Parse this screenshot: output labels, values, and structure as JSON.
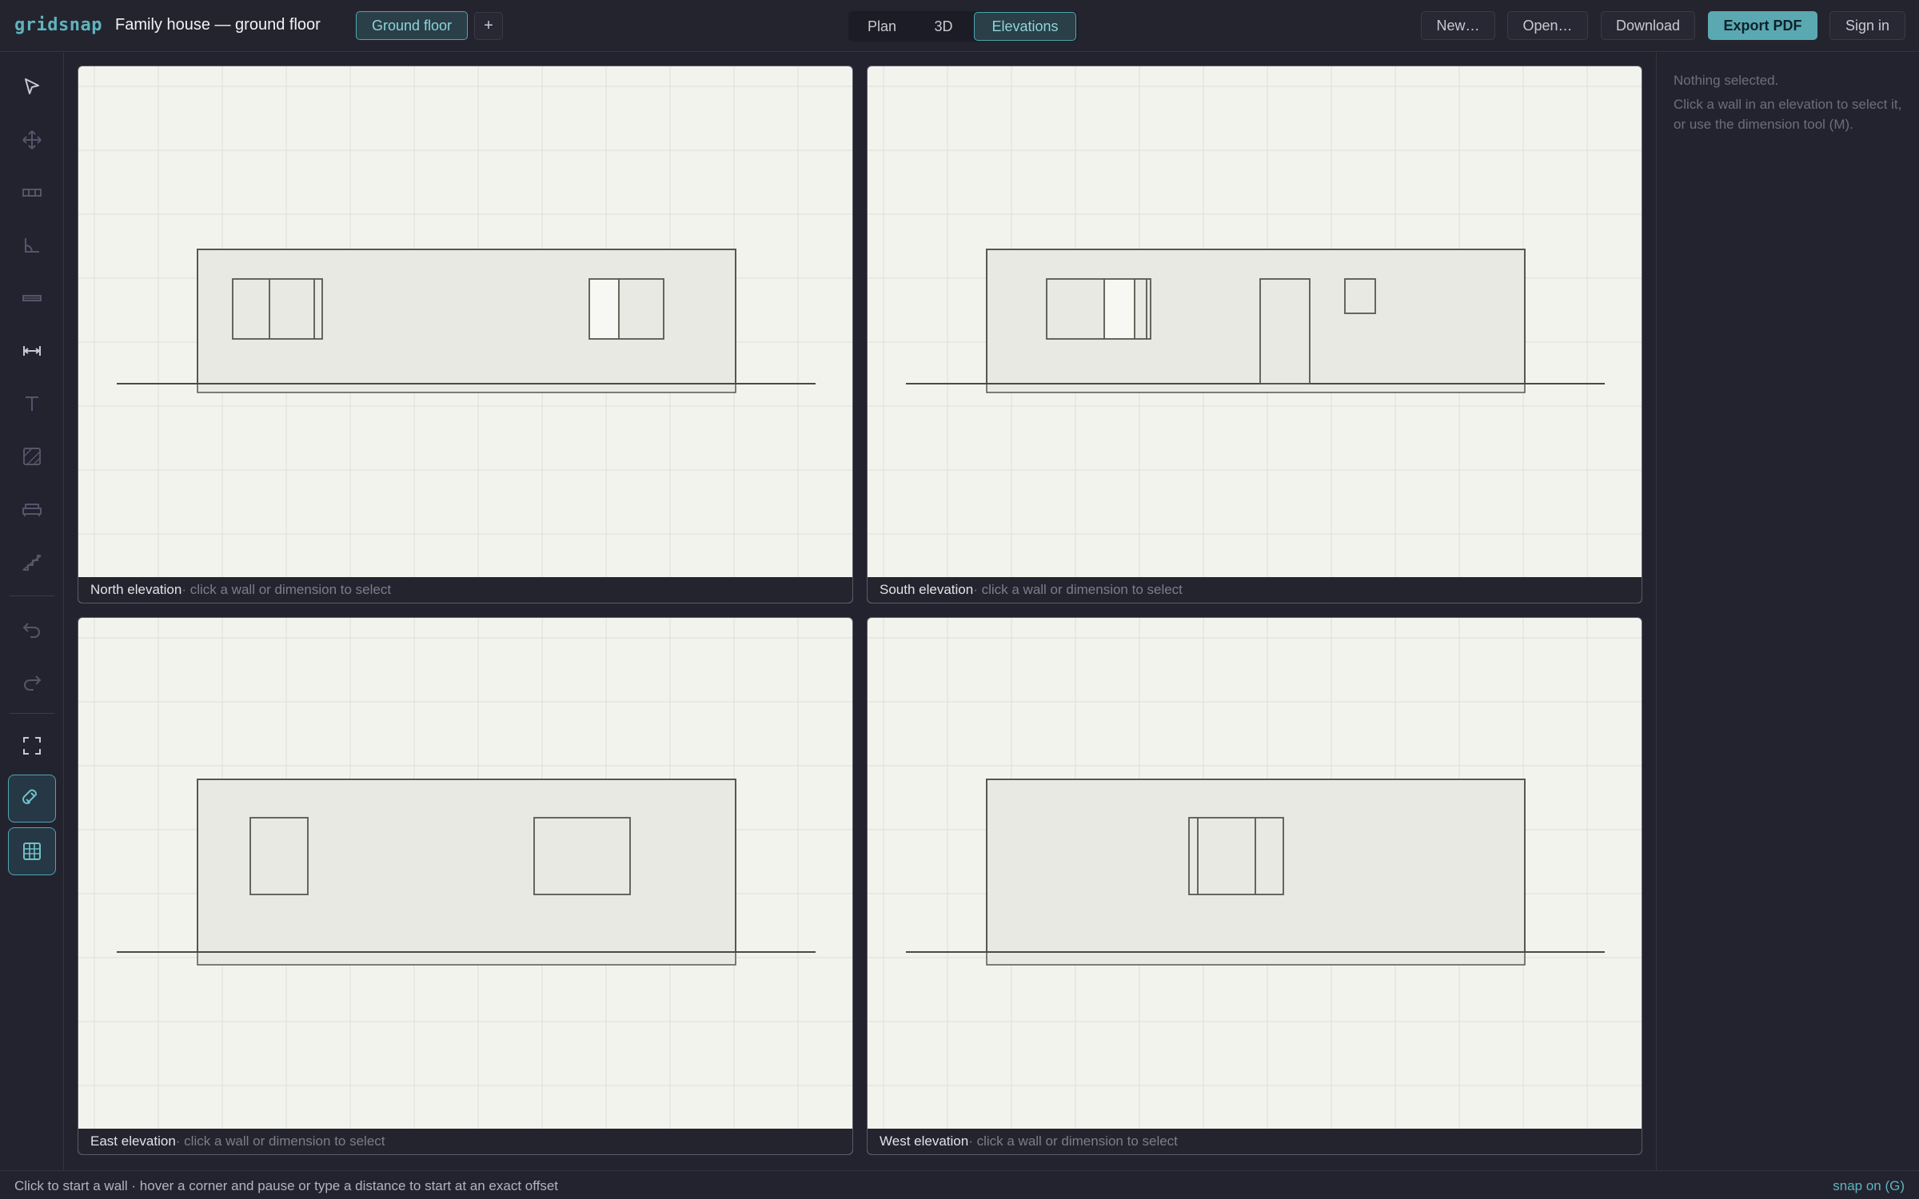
{
  "app": {
    "logo": "gridsnap",
    "document_title": "Family house — ground floor"
  },
  "floors": {
    "current": "Ground floor",
    "add_label": "+"
  },
  "views": {
    "plan": "Plan",
    "three_d": "3D",
    "elevations": "Elevations",
    "active": "Elevations"
  },
  "actions": {
    "new": "New…",
    "open": "Open…",
    "download": "Download",
    "export_pdf": "Export PDF",
    "sign_in": "Sign in"
  },
  "tools": [
    {
      "name": "select-tool",
      "icon": "pointer-icon"
    },
    {
      "name": "move-tool",
      "icon": "move-arrows-icon"
    },
    {
      "name": "wall-tool",
      "icon": "wall-icon"
    },
    {
      "name": "room-tool",
      "icon": "room-angle-icon"
    },
    {
      "name": "window-tool",
      "icon": "window-icon"
    },
    {
      "name": "dimension-tool",
      "icon": "dimension-icon"
    },
    {
      "name": "text-tool",
      "icon": "text-icon"
    },
    {
      "name": "hatch-tool",
      "icon": "hatch-icon"
    },
    {
      "name": "furniture-tool",
      "icon": "sofa-icon"
    },
    {
      "name": "stairs-tool",
      "icon": "stairs-icon"
    },
    {
      "name": "undo-button",
      "icon": "undo-icon"
    },
    {
      "name": "redo-button",
      "icon": "redo-icon"
    },
    {
      "name": "fit-view-button",
      "icon": "fit-view-icon"
    },
    {
      "name": "snap-toggle",
      "icon": "magnet-icon",
      "active": true
    },
    {
      "name": "grid-toggle",
      "icon": "grid-icon",
      "active": true
    }
  ],
  "elevations": [
    {
      "name": "North elevation",
      "hint": "· click a wall or dimension to select"
    },
    {
      "name": "South elevation",
      "hint": "· click a wall or dimension to select"
    },
    {
      "name": "East elevation",
      "hint": "· click a wall or dimension to select"
    },
    {
      "name": "West elevation",
      "hint": "· click a wall or dimension to select"
    }
  ],
  "selection": {
    "empty": "Nothing selected.",
    "help": "Click a wall in an elevation to select it, or use the dimension tool (M)."
  },
  "status": {
    "hint": "Click to start a wall · hover a corner and pause or type a distance to start at an exact offset",
    "snap": "snap on (G)"
  },
  "colors": {
    "accent": "#5aa9b2",
    "canvas": "#f3f3ee",
    "chrome": "#23232f"
  }
}
